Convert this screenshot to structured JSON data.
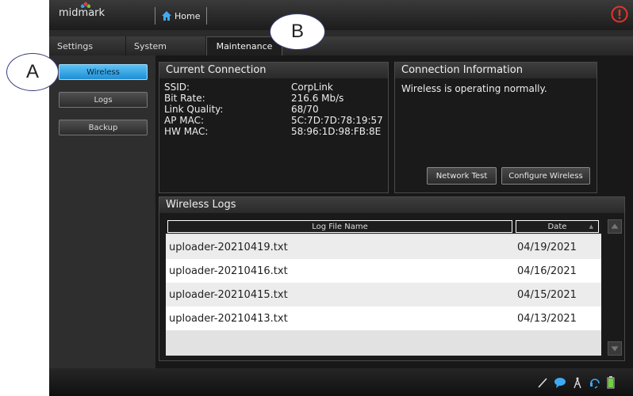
{
  "brand": {
    "logo_text": "midmark"
  },
  "header": {
    "home_label": "Home"
  },
  "tabs": [
    {
      "label": "Settings"
    },
    {
      "label": "System"
    },
    {
      "label": "Maintenance"
    }
  ],
  "sidebar": {
    "items": [
      {
        "label": "Wireless"
      },
      {
        "label": "Logs"
      },
      {
        "label": "Backup"
      }
    ]
  },
  "current_connection": {
    "title": "Current Connection",
    "labels": [
      "SSID:",
      "Bit Rate:",
      "Link Quality:",
      "AP MAC:",
      "HW MAC:"
    ],
    "values": [
      "CorpLink",
      "216.6 Mb/s",
      "68/70",
      "5C:7D:7D:78:19:57",
      "58:96:1D:98:FB:8E"
    ]
  },
  "connection_info": {
    "title": "Connection Information",
    "message": "Wireless is operating normally.",
    "network_test_label": "Network Test",
    "configure_label": "Configure Wireless"
  },
  "wireless_logs": {
    "title": "Wireless Logs",
    "columns": [
      "Log File Name",
      "Date"
    ],
    "sort_indicator": "▲",
    "rows": [
      {
        "name": "uploader-20210419.txt",
        "date": "04/19/2021"
      },
      {
        "name": "uploader-20210416.txt",
        "date": "04/16/2021"
      },
      {
        "name": "uploader-20210415.txt",
        "date": "04/15/2021"
      },
      {
        "name": "uploader-20210413.txt",
        "date": "04/13/2021"
      }
    ]
  },
  "callouts": {
    "a": "A",
    "b": "B"
  },
  "colors": {
    "accent": "#2ea6ea",
    "alert": "#e8332a"
  }
}
